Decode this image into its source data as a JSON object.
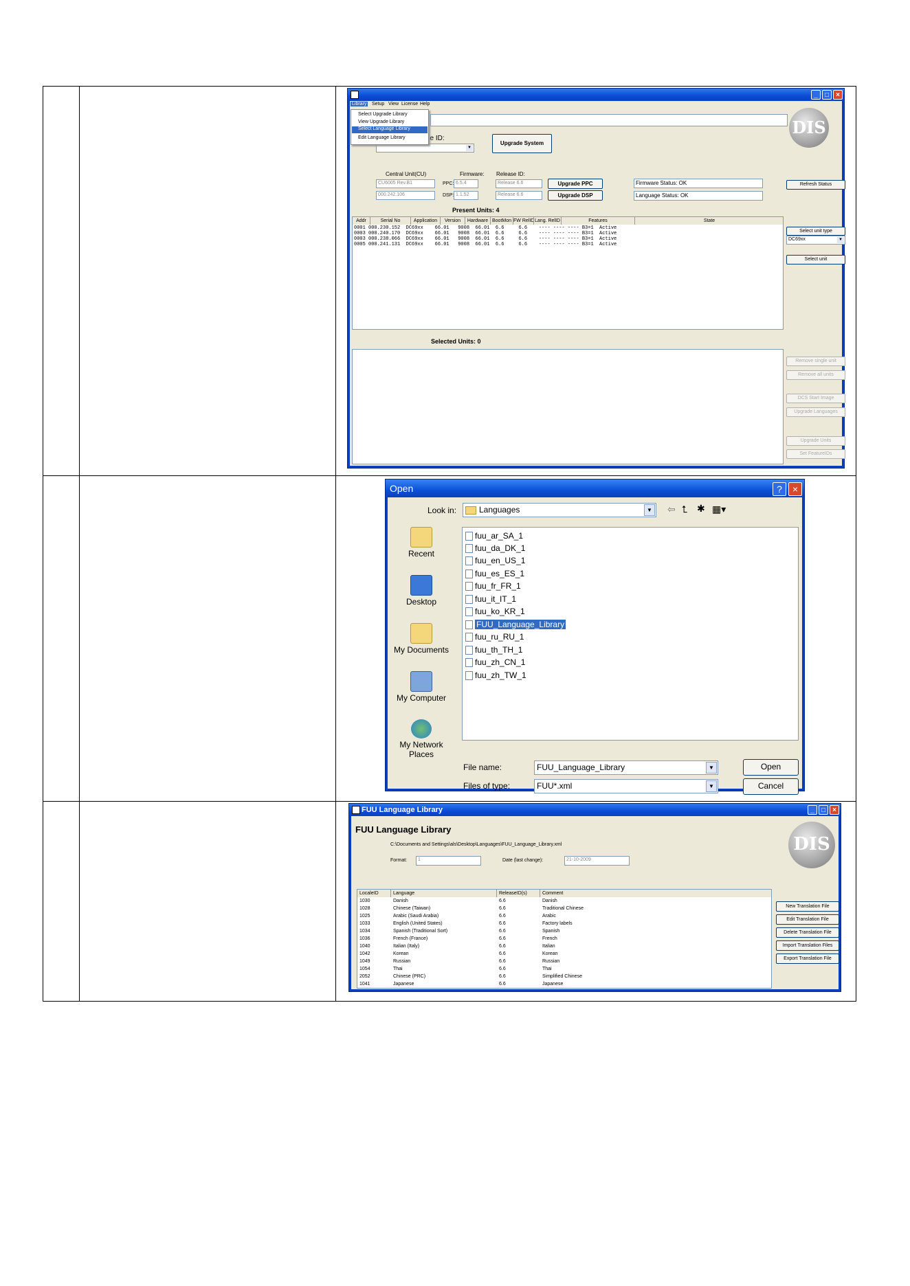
{
  "upgrade_window": {
    "menu": [
      "Library",
      "Setup",
      "View",
      "License",
      "Help"
    ],
    "dropdown": [
      "Select Upgrade Library",
      "View Upgrade Library",
      "Select Language Library",
      "Edit Language Library"
    ],
    "release_id_label": "ase ID:",
    "upgrade_system": "Upgrade System",
    "central_unit_label": "Central Unit(CU)",
    "firmware_label": "Firmware:",
    "release_label": "Release ID:",
    "cu_model": "CU6005 Rev.B1",
    "cu_serial": "000.242.106",
    "ppc_label": "PPC:",
    "dsp_label": "DSP:",
    "ppc_fw": "6.5.4",
    "dsp_fw": "1.1.52",
    "ppc_release": "Release 6.6",
    "dsp_release": "Release 6.6",
    "upgrade_ppc": "Upgrade PPC",
    "upgrade_dsp": "Upgrade DSP",
    "firmware_status": "Firmware Status: OK",
    "language_status": "Language Status: OK",
    "refresh_status": "Refresh Status",
    "present_units": "Present Units:   4",
    "columns": [
      "Addr",
      "Serial No",
      "Application",
      "Version",
      "Hardware",
      "BootMon",
      "FW RelID",
      "Lang. RelID",
      "Features",
      "State"
    ],
    "rows": [
      "0001 000.230.152  DC69xx    66.01   9008  66.01  6.6     6.6    ---- ---- ---- B3=1  Active",
      "0003 000.240.170  DC69xx    66.01   9008  66.01  6.6     6.6    ---- ---- ---- B3=1  Active",
      "0003 000.238.066  DC69xx    66.01   9008  66.01  6.6     6.6    ---- ---- ---- B3=1  Active",
      "0005 000.241.131  DC69xx    66.01   9008  66.01  6.6     6.6    ---- ---- ---- B3=1  Active"
    ],
    "select_unit_type": "Select unit type",
    "unit_type": "DC69xx",
    "select_unit": "Select unit",
    "selected_units": "Selected Units:  0",
    "remove_single": "Remove single unit",
    "remove_all": "Remove all units",
    "dcs_start": "DCS Start Image",
    "upgrade_languages": "Upgrade Languages",
    "upgrade_units": "Upgrade Units",
    "set_feature": "Set FeatureIDs"
  },
  "open_dialog": {
    "title": "Open",
    "look_in_label": "Look in:",
    "look_in_value": "Languages",
    "places": [
      "Recent",
      "Desktop",
      "My Documents",
      "My Computer",
      "My Network Places"
    ],
    "files": [
      "fuu_ar_SA_1",
      "fuu_da_DK_1",
      "fuu_en_US_1",
      "fuu_es_ES_1",
      "fuu_fr_FR_1",
      "fuu_it_IT_1",
      "fuu_ko_KR_1",
      "FUU_Language_Library",
      "fuu_ru_RU_1",
      "fuu_th_TH_1",
      "fuu_zh_CN_1",
      "fuu_zh_TW_1"
    ],
    "selected_file": "FUU_Language_Library",
    "file_name_label": "File name:",
    "file_name_value": "FUU_Language_Library",
    "files_of_type_label": "Files of type:",
    "files_of_type_value": "FUU*.xml",
    "open_button": "Open",
    "cancel_button": "Cancel"
  },
  "library_window": {
    "title": "FUU Language Library",
    "heading": "FUU Language Library",
    "path": "C:\\Documents and Settings\\als\\Desktop\\Languages\\FUU_Language_Library.xml",
    "format_label": "Format:",
    "format_value": "1",
    "date_label": "Date (last change):",
    "date_value": "21-10-2009",
    "columns": [
      "LocaleID",
      "Language",
      "ReleaseID(s)",
      "Comment"
    ],
    "rows": [
      [
        "1030",
        "Danish",
        "6.6",
        "Danish"
      ],
      [
        "1028",
        "Chinese (Taiwan)",
        "6.6",
        "Traditional Chinese"
      ],
      [
        "1025",
        "Arabic (Saudi Arabia)",
        "6.6",
        "Arabic"
      ],
      [
        "1033",
        "English (United States)",
        "6.6",
        "Factory labels"
      ],
      [
        "1034",
        "Spanish (Traditional Sort)",
        "6.6",
        "Spanish"
      ],
      [
        "1036",
        "French (France)",
        "6.6",
        "French"
      ],
      [
        "1040",
        "Italian (Italy)",
        "6.6",
        "Italian"
      ],
      [
        "1042",
        "Korean",
        "6.6",
        "Korean"
      ],
      [
        "1049",
        "Russian",
        "6.6",
        "Russian"
      ],
      [
        "1054",
        "Thai",
        "6.6",
        "Thai"
      ],
      [
        "2052",
        "Chinese (PRC)",
        "6.6",
        "Simplified Chinese"
      ],
      [
        "1041",
        "Japanese",
        "6.6",
        "Japanese"
      ]
    ],
    "buttons": [
      "New Translation File",
      "Edit Translation File",
      "Delete Translation File",
      "Import Translation Files",
      "Export Translation File"
    ]
  }
}
